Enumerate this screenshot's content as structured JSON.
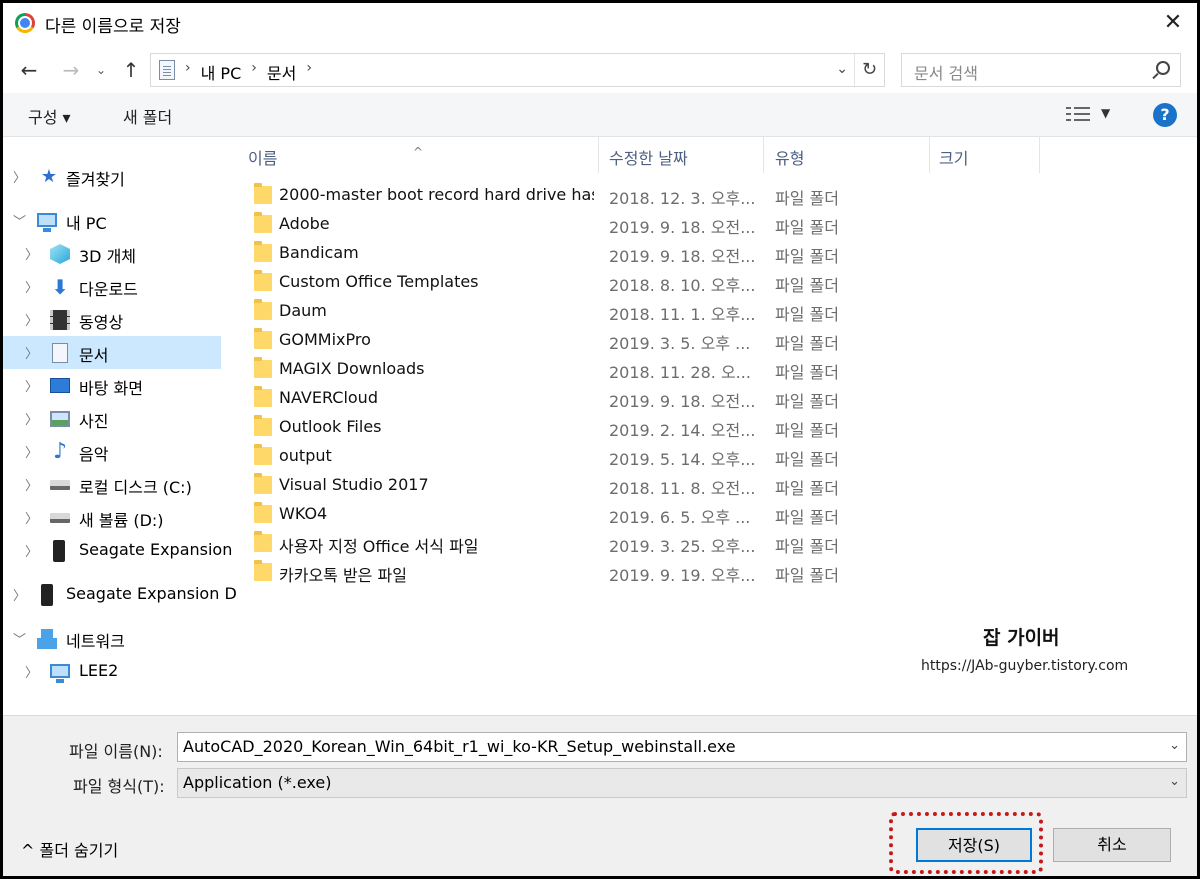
{
  "window": {
    "title": "다른 이름으로 저장",
    "close_icon": "close-icon"
  },
  "address": {
    "crumbs": [
      "내 PC",
      "문서"
    ],
    "search_placeholder": "문서 검색"
  },
  "toolbar": {
    "organize_label": "구성 ▾",
    "new_folder_label": "새 폴더",
    "help_label": "?"
  },
  "sidebar": {
    "items": [
      {
        "label": "즐겨찾기",
        "icon": "star-icon"
      },
      {
        "label": "내 PC",
        "icon": "computer-icon"
      },
      {
        "label": "3D 개체",
        "icon": "3d-objects-icon"
      },
      {
        "label": "다운로드",
        "icon": "download-icon"
      },
      {
        "label": "동영상",
        "icon": "video-icon"
      },
      {
        "label": "문서",
        "icon": "document-icon"
      },
      {
        "label": "바탕 화면",
        "icon": "desktop-icon"
      },
      {
        "label": "사진",
        "icon": "picture-icon"
      },
      {
        "label": "음악",
        "icon": "music-icon"
      },
      {
        "label": "로컬 디스크 (C:)",
        "icon": "local-disk-icon"
      },
      {
        "label": "새 볼륨 (D:)",
        "icon": "volume-icon"
      },
      {
        "label": "Seagate Expansion",
        "icon": "usb-drive-icon"
      },
      {
        "label": "Seagate Expansion D",
        "icon": "usb-drive-icon"
      },
      {
        "label": "네트워크",
        "icon": "network-icon"
      },
      {
        "label": "LEE2",
        "icon": "computer-icon"
      }
    ],
    "selected": "문서"
  },
  "columns": {
    "name": "이름",
    "modified": "수정한 날짜",
    "type": "유형",
    "size": "크기"
  },
  "files": [
    {
      "name": "2000-master boot record hard drive has...",
      "date": "2018. 12. 3. 오후...",
      "type": "파일 폴더"
    },
    {
      "name": "Adobe",
      "date": "2019. 9. 18. 오전...",
      "type": "파일 폴더"
    },
    {
      "name": "Bandicam",
      "date": "2019. 9. 18. 오전...",
      "type": "파일 폴더"
    },
    {
      "name": "Custom Office Templates",
      "date": "2018. 8. 10. 오후...",
      "type": "파일 폴더"
    },
    {
      "name": "Daum",
      "date": "2018. 11. 1. 오후...",
      "type": "파일 폴더"
    },
    {
      "name": "GOMMixPro",
      "date": "2019. 3. 5. 오후 ...",
      "type": "파일 폴더"
    },
    {
      "name": "MAGIX Downloads",
      "date": "2018. 11. 28. 오...",
      "type": "파일 폴더"
    },
    {
      "name": "NAVERCloud",
      "date": "2019. 9. 18. 오전...",
      "type": "파일 폴더"
    },
    {
      "name": "Outlook Files",
      "date": "2019. 2. 14. 오전...",
      "type": "파일 폴더"
    },
    {
      "name": "output",
      "date": "2019. 5. 14. 오후...",
      "type": "파일 폴더"
    },
    {
      "name": "Visual Studio 2017",
      "date": "2018. 11. 8. 오전...",
      "type": "파일 폴더"
    },
    {
      "name": "WKO4",
      "date": "2019. 6. 5. 오후 ...",
      "type": "파일 폴더"
    },
    {
      "name": "사용자 지정 Office 서식 파일",
      "date": "2019. 3. 25. 오후...",
      "type": "파일 폴더"
    },
    {
      "name": "카카오톡 받은 파일",
      "date": "2019. 9. 19. 오후...",
      "type": "파일 폴더"
    }
  ],
  "watermark": {
    "title": "잡 가이버",
    "url": "https://JAb-guyber.tistory.com"
  },
  "footer": {
    "filename_label": "파일 이름(N):",
    "filename_value": "AutoCAD_2020_Korean_Win_64bit_r1_wi_ko-KR_Setup_webinstall.exe",
    "filetype_label": "파일 형식(T):",
    "filetype_value": "Application (*.exe)",
    "hide_folders_label": "^ 폴더 숨기기",
    "save_label": "저장(S)",
    "cancel_label": "취소"
  },
  "colors": {
    "selection": "#cce8ff",
    "accent": "#0078d7",
    "folder": "#ffd86a",
    "highlight": "#c51a1a"
  }
}
